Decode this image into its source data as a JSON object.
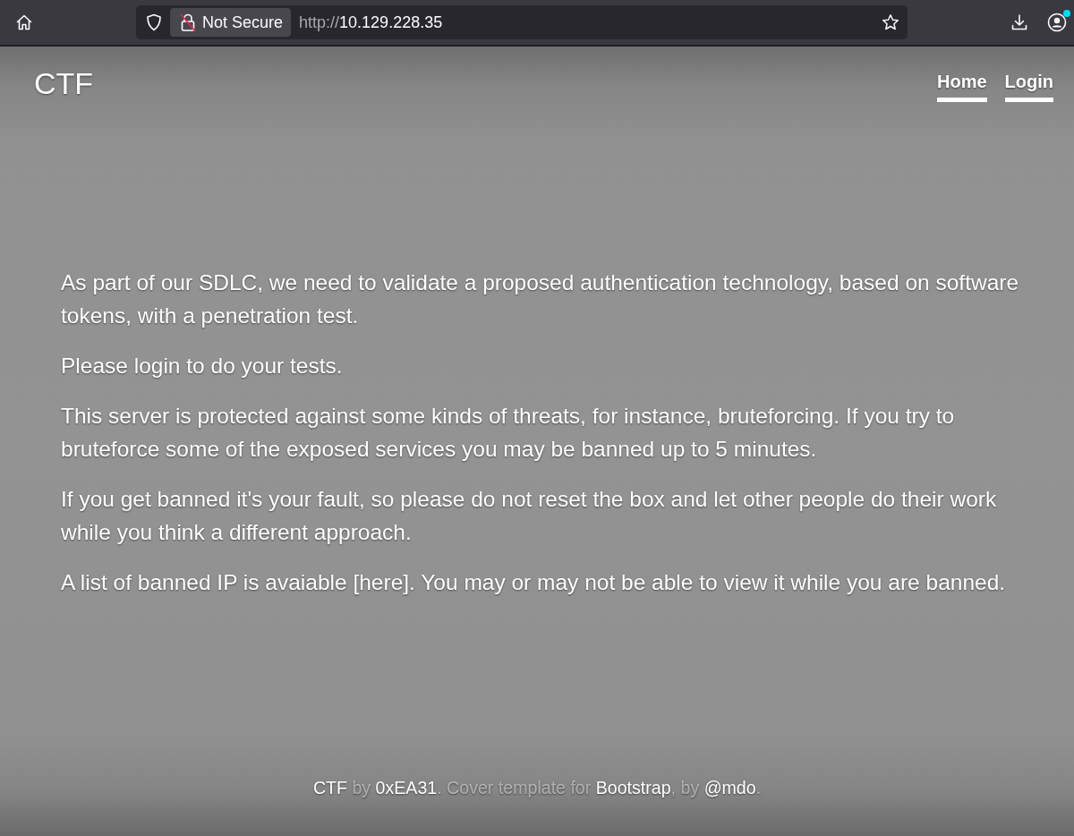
{
  "browser": {
    "security_label": "Not Secure",
    "url": {
      "scheme": "http://",
      "host": "10.129.228.35"
    },
    "account_badge": true
  },
  "site": {
    "brand": "CTF",
    "nav": [
      {
        "label": "Home"
      },
      {
        "label": "Login"
      }
    ]
  },
  "content": {
    "paragraphs": [
      "As part of our SDLC, we need to validate a proposed authentication technology, based on software tokens, with a penetration test.",
      "Please login to do your tests.",
      "This server is protected against some kinds of threats, for instance, bruteforcing. If you try to bruteforce some of the exposed services you may be banned up to 5 minutes.",
      "If you get banned it's your fault, so please do not reset the box and let other people do their work while you think a different approach.",
      "A list of banned IP is avaiable [here]. You may or may not be able to view it while you are banned."
    ]
  },
  "footer": {
    "parts": [
      {
        "kind": "link",
        "text": "CTF"
      },
      {
        "kind": "text",
        "text": " by "
      },
      {
        "kind": "link",
        "text": "0xEA31"
      },
      {
        "kind": "text",
        "text": ". Cover template for "
      },
      {
        "kind": "link",
        "text": "Bootstrap"
      },
      {
        "kind": "text",
        "text": ", by "
      },
      {
        "kind": "link",
        "text": "@mdo"
      },
      {
        "kind": "text",
        "text": "."
      }
    ]
  }
}
